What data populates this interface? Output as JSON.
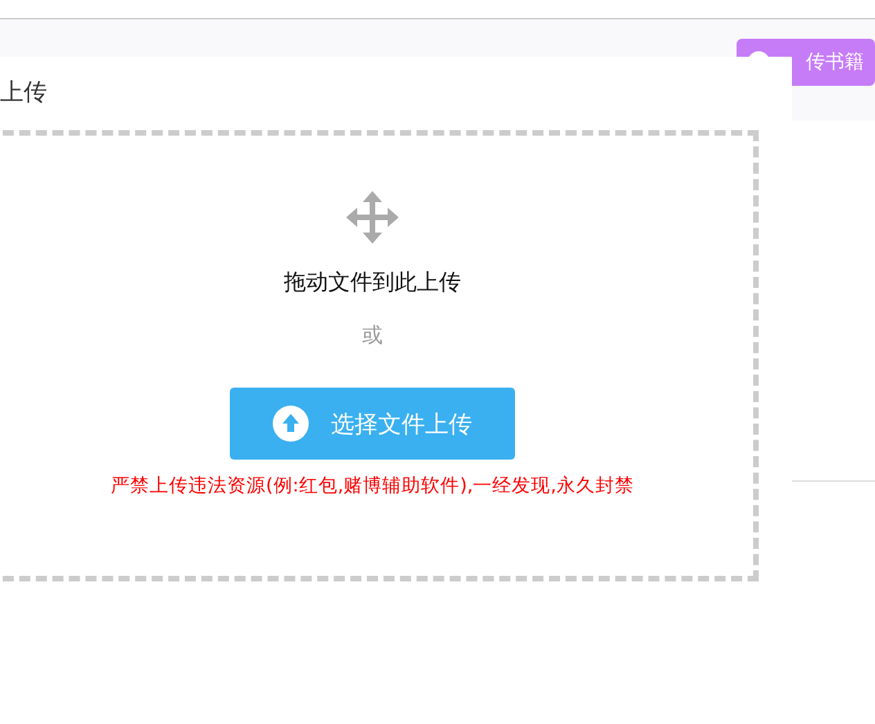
{
  "toolbar": {
    "upload_button": "传书籍"
  },
  "dialog": {
    "title": "上传",
    "drop_hint": "拖动文件到此上传",
    "or": "或",
    "select_button": "选择文件上传",
    "warning": "严禁上传违法资源(例:红包,赌博辅助软件),一经发现,永久封禁"
  }
}
